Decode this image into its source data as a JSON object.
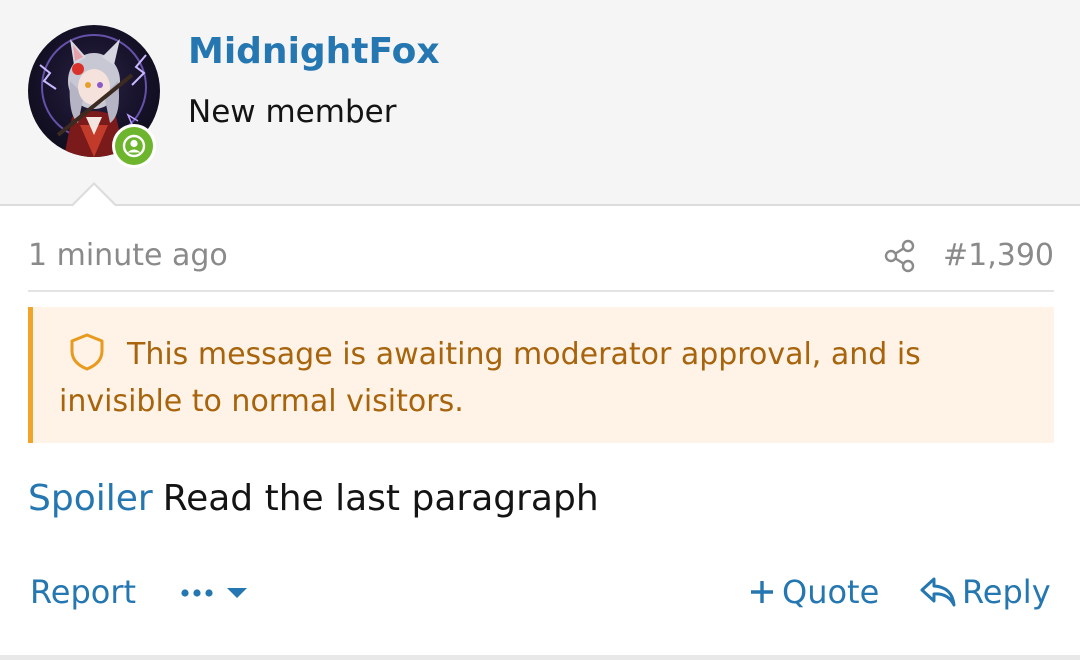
{
  "user": {
    "username": "MidnightFox",
    "title": "New member",
    "status": "online"
  },
  "post": {
    "timestamp": "1 minute ago",
    "post_number": "#1,390",
    "notice": "This message is awaiting moderator approval, and is invisible to normal visitors.",
    "spoiler_label": "Spoiler",
    "body": "Read the last paragraph"
  },
  "actions": {
    "report_label": "Report",
    "quote_label": "Quote",
    "reply_label": "Reply"
  },
  "icons": {
    "share": "share-icon",
    "shield": "shield-icon",
    "more": "ellipsis-icon",
    "dropdown": "caret-down-icon",
    "quote": "plus-icon",
    "reply": "reply-arrow-icon",
    "online": "user-icon"
  },
  "colors": {
    "link": "#2577b1",
    "notice_text": "#a8640d",
    "notice_bg": "#fef3e6",
    "notice_border": "#f0a42a",
    "online_badge": "#6cb52d",
    "muted": "#8a8a8a"
  }
}
